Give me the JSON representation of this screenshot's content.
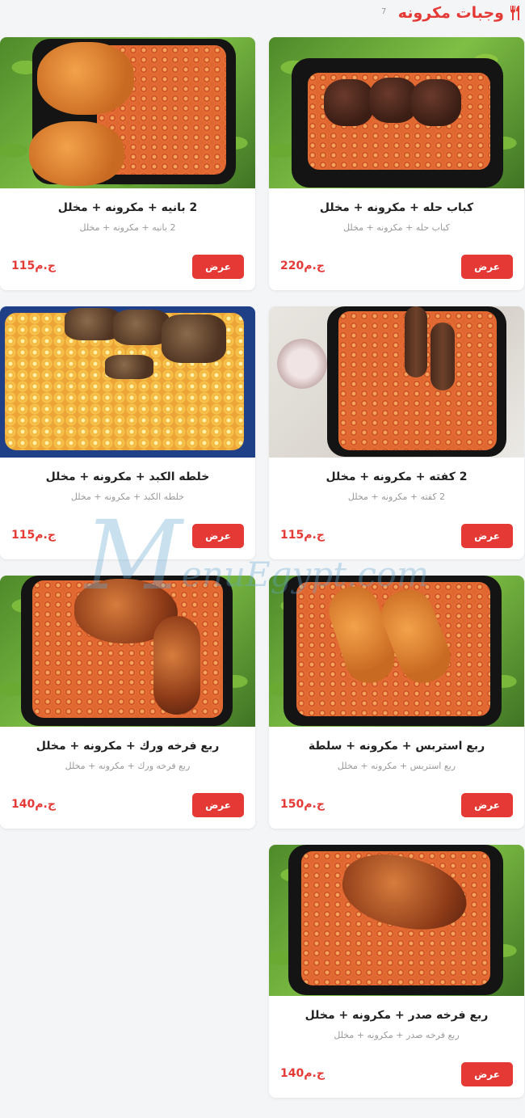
{
  "header": {
    "title": "وجبات مكرونه",
    "count": "7",
    "icon": "fork-knife-icon"
  },
  "accent_color": "#e53935",
  "items": [
    {
      "name": "كباب حله + مكرونه + مخلل",
      "desc": "كباب حله + مكرونه + مخلل",
      "price": "220",
      "currency": "ج.م",
      "button": "عرض"
    },
    {
      "name": "2 بانيه + مكرونه + مخلل",
      "desc": "2 بانيه + مكرونه + مخلل",
      "price": "115",
      "currency": "ج.م",
      "button": "عرض"
    },
    {
      "name": "2 كفته + مكرونه + مخلل",
      "desc": "2 كفته + مكرونه + مخلل",
      "price": "115",
      "currency": "ج.م",
      "button": "عرض"
    },
    {
      "name": "خلطه الكبد + مكرونه + مخلل",
      "desc": "خلطه الكبد + مكرونه + مخلل",
      "price": "115",
      "currency": "ج.م",
      "button": "عرض"
    },
    {
      "name": "ربع استربس + مكرونه + سلطة",
      "desc": "ربع استربس + مكرونه + مخلل",
      "price": "150",
      "currency": "ج.م",
      "button": "عرض"
    },
    {
      "name": "ربع فرخه ورك + مكرونه + مخلل",
      "desc": "ربع فرخه ورك + مكرونه + مخلل",
      "price": "140",
      "currency": "ج.م",
      "button": "عرض"
    },
    {
      "name": "ربع فرخه صدر + مكرونه + مخلل",
      "desc": "ربع فرخه صدر + مكرونه + مخلل",
      "price": "140",
      "currency": "ج.م",
      "button": "عرض"
    }
  ],
  "watermark": {
    "letter": "M",
    "text": "enuEgypt.com"
  }
}
